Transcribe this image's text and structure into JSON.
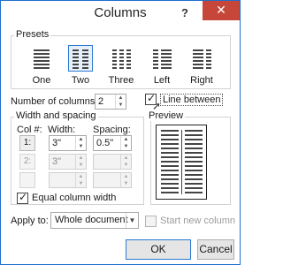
{
  "dialog": {
    "title": "Columns",
    "help": "?",
    "close": "✕"
  },
  "presets": {
    "label": "Presets",
    "items": [
      {
        "label": "One",
        "selected": false
      },
      {
        "label": "Two",
        "selected": true
      },
      {
        "label": "Three",
        "selected": false
      },
      {
        "label": "Left",
        "selected": false
      },
      {
        "label": "Right",
        "selected": false
      }
    ]
  },
  "number_of_columns": {
    "label": "Number of columns:",
    "value": "2"
  },
  "line_between": {
    "label": "Line between",
    "checked": true
  },
  "width_and_spacing": {
    "label": "Width and spacing",
    "col_header": "Col #:",
    "width_header": "Width:",
    "spacing_header": "Spacing:",
    "rows": [
      {
        "col": "1:",
        "width": "3\"",
        "spacing": "0.5\"",
        "enabled": true
      },
      {
        "col": "2:",
        "width": "3\"",
        "spacing": "",
        "enabled": false
      },
      {
        "col": "",
        "width": "",
        "spacing": "",
        "enabled": false
      }
    ],
    "equal_width": {
      "label": "Equal column width",
      "checked": true
    }
  },
  "preview": {
    "label": "Preview"
  },
  "apply_to": {
    "label": "Apply to:",
    "value": "Whole document"
  },
  "start_new_column": {
    "label": "Start new column",
    "checked": false
  },
  "buttons": {
    "ok": "OK",
    "cancel": "Cancel"
  }
}
